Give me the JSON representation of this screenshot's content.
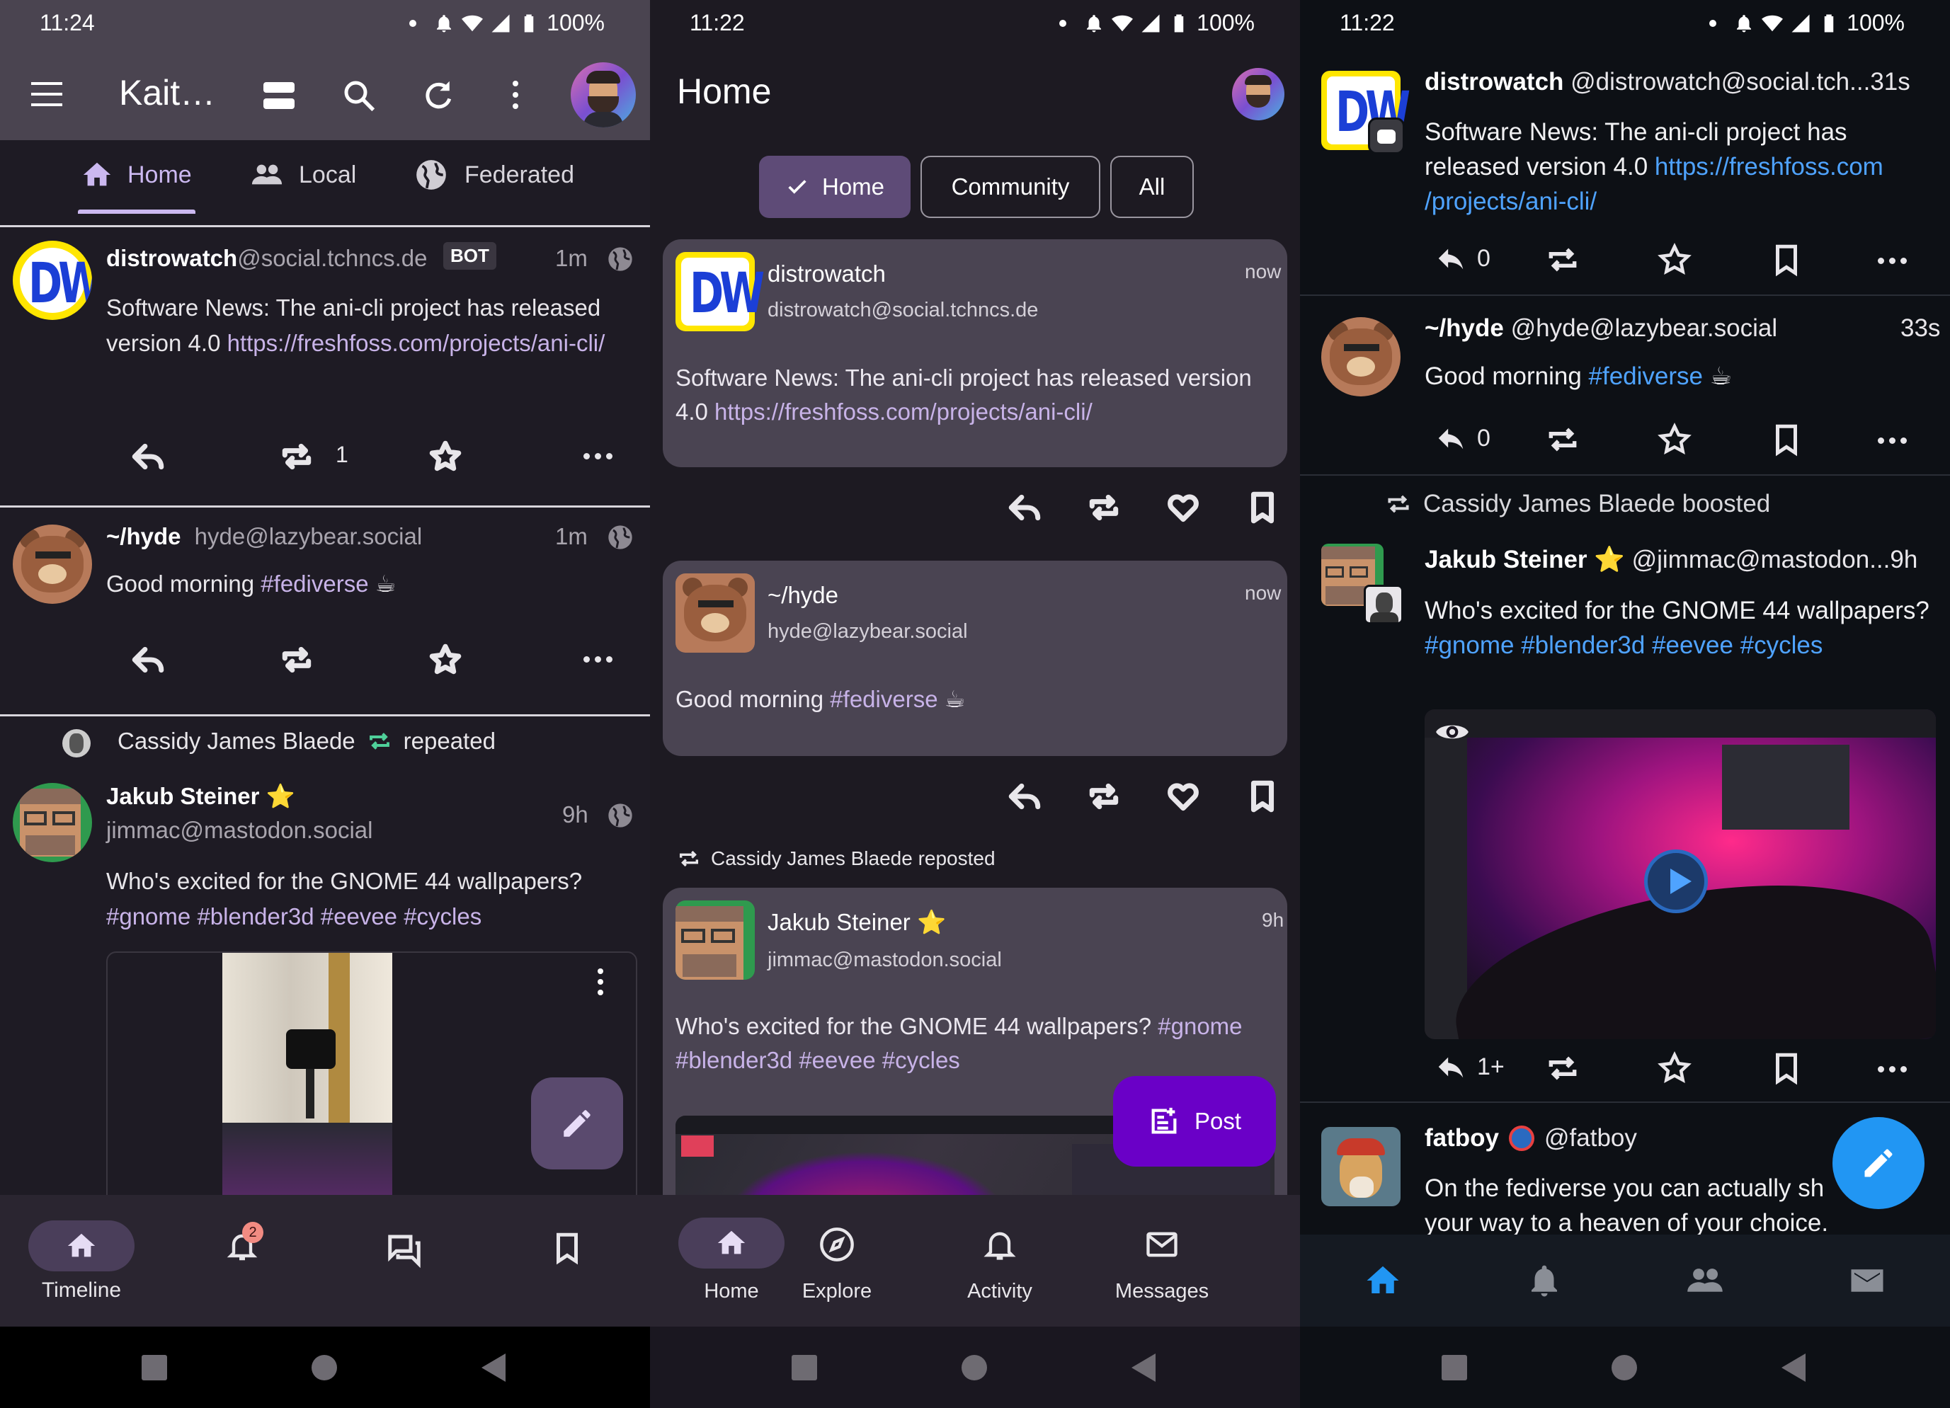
{
  "status": {
    "p1_time": "11:24",
    "p2_time": "11:22",
    "p3_time": "11:22",
    "battery": "100%"
  },
  "p1": {
    "title": "Kait…",
    "tabs": [
      {
        "label": "Home",
        "icon": "home-icon"
      },
      {
        "label": "Local",
        "icon": "people-icon"
      },
      {
        "label": "Federated",
        "icon": "globe-icon"
      }
    ],
    "posts": [
      {
        "name": "distrowatch",
        "handle": "@social.tchncs.de",
        "badge": "BOT",
        "time": "1m",
        "text": "Software News: The ani-cli project has released version 4.0 ",
        "link": "https://freshfoss.com/projects/ani-cli/",
        "boosts": "1"
      },
      {
        "name": "~/hyde",
        "handle": "hyde@lazybear.social",
        "time": "1m",
        "text": "Good morning ",
        "tag": "#fediverse",
        "emoji": " ☕"
      },
      {
        "repeat_name": "Cassidy James Blaede",
        "repeat_text": "repeated",
        "name": "Jakub Steiner",
        "star": "⭐",
        "handle": "jimmac@mastodon.social",
        "time": "9h",
        "text": "Who's excited for the GNOME 44 wallpapers?",
        "tags": [
          "#gnome",
          "#blender3d",
          "#eevee",
          "#cycles"
        ]
      }
    ],
    "nav": [
      {
        "label": "Timeline",
        "icon": "home-icon"
      },
      {
        "label": "",
        "icon": "bell-icon",
        "badge": "2"
      },
      {
        "label": "",
        "icon": "conversations-icon"
      },
      {
        "label": "",
        "icon": "bookmark-icon"
      }
    ]
  },
  "p2": {
    "title": "Home",
    "chips": [
      {
        "label": "Home",
        "selected": true
      },
      {
        "label": "Community",
        "selected": false
      },
      {
        "label": "All",
        "selected": false
      }
    ],
    "posts": [
      {
        "name": "distrowatch",
        "handle": "distrowatch@social.tchncs.de",
        "time": "now",
        "text": "Software News: The ani-cli project has released version 4.0 ",
        "link": "https://freshfoss.com/projects/ani-cli/"
      },
      {
        "name": "~/hyde",
        "handle": "hyde@lazybear.social",
        "time": "now",
        "text": "Good morning ",
        "tag": "#fediverse",
        "emoji": " ☕"
      },
      {
        "repost": "Cassidy James Blaede reposted",
        "name": "Jakub Steiner",
        "star": "⭐",
        "handle": "jimmac@mastodon.social",
        "time": "9h",
        "text": "Who's excited for the GNOME 44 wallpapers? ",
        "tags": [
          "#gnome",
          "#blender3d",
          "#eevee",
          "#cycles"
        ]
      }
    ],
    "post_button": "Post",
    "nav": [
      {
        "label": "Home",
        "icon": "home-icon"
      },
      {
        "label": "Explore",
        "icon": "compass-icon"
      },
      {
        "label": "Activity",
        "icon": "bell-icon"
      },
      {
        "label": "Messages",
        "icon": "mail-icon"
      }
    ]
  },
  "p3": {
    "posts": [
      {
        "name": "distrowatch",
        "handle": "@distrowatch@social.tch...",
        "time": "31s",
        "text": "Software News: The ani-cli project has released version 4.0 ",
        "link1": "https://freshfoss.com",
        "link2": "/projects/ani-cli/",
        "replies": "0"
      },
      {
        "name": "~/hyde",
        "handle": "@hyde@lazybear.social",
        "time": "33s",
        "text": "Good morning ",
        "tag": "#fediverse",
        "emoji": " ☕",
        "replies": "0"
      },
      {
        "boosted": "Cassidy James Blaede boosted",
        "name": "Jakub Steiner",
        "star": "⭐",
        "handle": "@jimmac@mastodon...",
        "time": "9h",
        "text": "Who's excited for the GNOME 44 wallpapers? ",
        "tags": "#gnome #blender3d #eevee #cycles",
        "replies": "1+"
      },
      {
        "name": "fatboy",
        "handle": "@fatboy",
        "text": "On the fediverse you can actually sh",
        "text2": "your way to a heaven of your choice."
      }
    ]
  },
  "colors": {
    "accent_purple": "#5e4b77",
    "fab_purple": "#6a00c7",
    "link_blue": "#4fa3ff",
    "fab_blue": "#2196f3"
  }
}
